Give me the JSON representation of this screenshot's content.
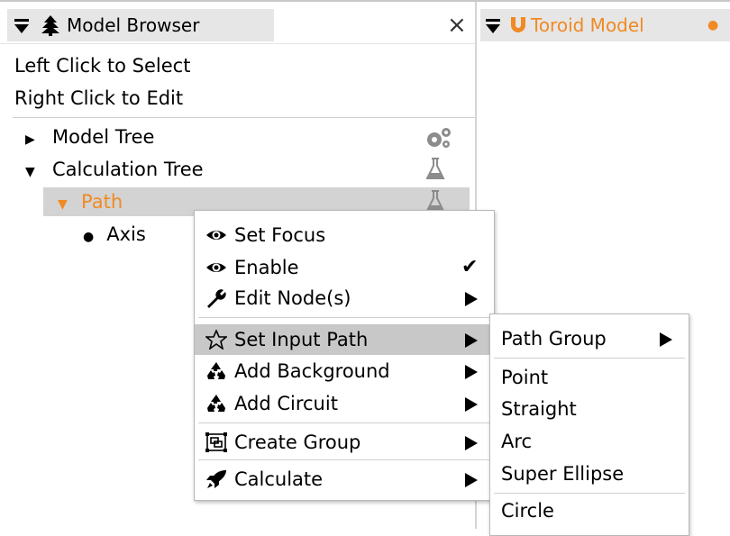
{
  "left_tab": {
    "title": "Model Browser",
    "close": "×"
  },
  "right_tab": {
    "title": "Toroid Model",
    "dot": "●"
  },
  "colors": {
    "accent": "#f08a24",
    "selection": "#d3d3d3",
    "icon_gray": "#8c8c8c"
  },
  "hints": {
    "line1": "Left Click to Select",
    "line2": "Right Click to Edit"
  },
  "tree": {
    "model_tree": "Model Tree",
    "calculation_tree": "Calculation Tree",
    "path": "Path",
    "axis": "Axis",
    "icons": {
      "model_tree": "gears-icon",
      "calculation_tree": "flask-icon",
      "path": "flask-icon"
    }
  },
  "context_menu": {
    "items": [
      {
        "label": "Set Focus",
        "icon": "eye-icon"
      },
      {
        "label": "Enable",
        "icon": "eye-icon",
        "check": "✔"
      },
      {
        "label": "Edit Node(s)",
        "icon": "wrench-icon"
      },
      {
        "label": "Set Input Path",
        "icon": "star-icon"
      },
      {
        "label": "Add Background",
        "icon": "recycle-icon"
      },
      {
        "label": "Add Circuit",
        "icon": "recycle-icon"
      },
      {
        "label": "Create Group",
        "icon": "group-icon"
      },
      {
        "label": "Calculate",
        "icon": "rocket-icon"
      }
    ]
  },
  "submenu": {
    "items": [
      {
        "label": "Path Group"
      },
      {
        "label": "Point"
      },
      {
        "label": "Straight"
      },
      {
        "label": "Arc"
      },
      {
        "label": "Super Ellipse"
      },
      {
        "label": "Circle"
      }
    ]
  }
}
